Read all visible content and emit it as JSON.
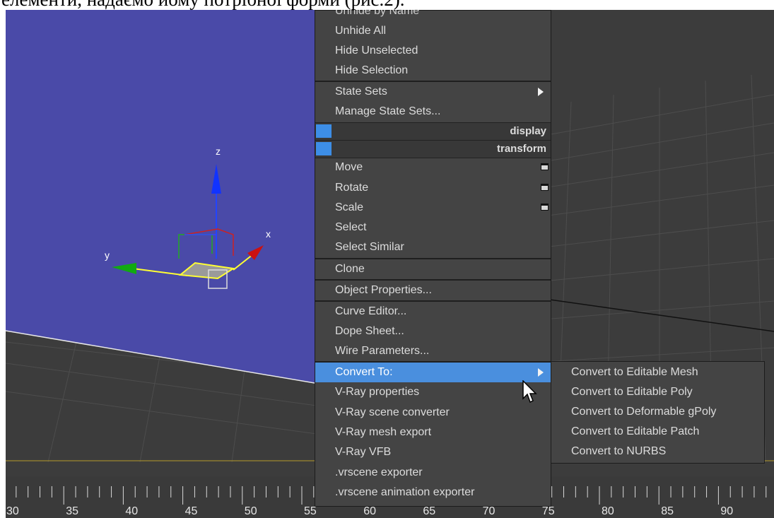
{
  "caption": "елементи, надаємо йому потрібної форми (рис.2).",
  "viewport": {
    "axis_labels": {
      "x": "x",
      "y": "y",
      "z": "z"
    },
    "colors": {
      "viewport_blue": "#4a4aa8",
      "grid_dark": "#3b3b3b",
      "gizmo_yellow": "#ffff33",
      "axis_red": "#cc1111",
      "axis_green": "#11aa11",
      "axis_blue": "#1111dd"
    }
  },
  "context_menu": {
    "items": [
      {
        "label": "Unhide by Name"
      },
      {
        "label": "Unhide All"
      },
      {
        "label": "Hide Unselected"
      },
      {
        "label": "Hide Selection"
      },
      {
        "label": "State Sets"
      },
      {
        "label": "Manage State Sets..."
      },
      {
        "label": "Move"
      },
      {
        "label": "Rotate"
      },
      {
        "label": "Scale"
      },
      {
        "label": "Select"
      },
      {
        "label": "Select Similar"
      },
      {
        "label": "Clone"
      },
      {
        "label": "Object Properties..."
      },
      {
        "label": "Curve Editor..."
      },
      {
        "label": "Dope Sheet..."
      },
      {
        "label": "Wire Parameters..."
      },
      {
        "label": "Convert To:"
      },
      {
        "label": "V-Ray properties"
      },
      {
        "label": "V-Ray scene converter"
      },
      {
        "label": "V-Ray mesh export"
      },
      {
        "label": "V-Ray VFB"
      },
      {
        "label": ".vrscene exporter"
      },
      {
        "label": ".vrscene animation exporter"
      }
    ],
    "quads": [
      {
        "label": "display"
      },
      {
        "label": "transform"
      }
    ]
  },
  "submenu": {
    "items": [
      {
        "label": "Convert to Editable Mesh"
      },
      {
        "label": "Convert to Editable Poly"
      },
      {
        "label": "Convert to Deformable gPoly"
      },
      {
        "label": "Convert to Editable Patch"
      },
      {
        "label": "Convert to NURBS"
      }
    ]
  },
  "timeline": {
    "labels": [
      "30",
      "35",
      "40",
      "45",
      "50",
      "55",
      "60",
      "65",
      "70",
      "75",
      "80",
      "85",
      "90"
    ]
  }
}
